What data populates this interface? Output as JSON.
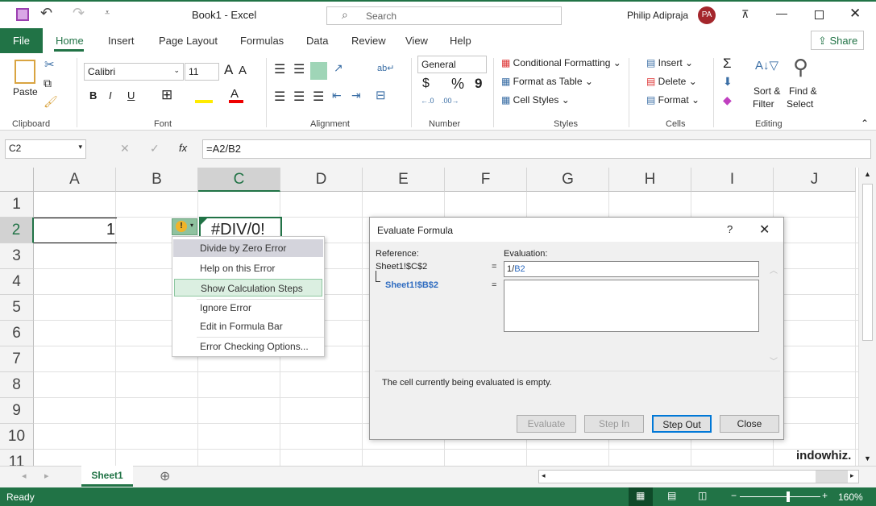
{
  "titlebar": {
    "title": "Book1  -  Excel",
    "search_placeholder": "Search",
    "user": "Philip Adipraja",
    "avatar": "PA",
    "avatar_color": "#a4262c"
  },
  "tabs": {
    "file": "File",
    "items": [
      "Home",
      "Insert",
      "Page Layout",
      "Formulas",
      "Data",
      "Review",
      "View",
      "Help"
    ],
    "active": "Home",
    "share": "Share"
  },
  "ribbon": {
    "clipboard": {
      "label": "Clipboard",
      "paste": "Paste"
    },
    "font": {
      "label": "Font",
      "name": "Calibri",
      "size": "11",
      "bold": "B",
      "italic": "I",
      "underline": "U"
    },
    "alignment": {
      "label": "Alignment"
    },
    "number": {
      "label": "Number",
      "format": "General",
      "currency": "$",
      "percent": "%",
      "comma": "9"
    },
    "styles": {
      "label": "Styles",
      "conditional": "Conditional Formatting",
      "table": "Format as Table",
      "cell_styles": "Cell Styles"
    },
    "cells": {
      "label": "Cells",
      "insert": "Insert",
      "delete": "Delete",
      "format": "Format"
    },
    "editing": {
      "label": "Editing",
      "sort": "Sort &",
      "filter": "Filter",
      "find": "Find &",
      "select": "Select"
    }
  },
  "formula_bar": {
    "name_box": "C2",
    "fx": "fx",
    "formula": "=A2/B2"
  },
  "grid": {
    "columns": [
      "A",
      "B",
      "C",
      "D",
      "E",
      "F",
      "G",
      "H",
      "I",
      "J"
    ],
    "rows": [
      "1",
      "2",
      "3",
      "4",
      "5",
      "6",
      "7",
      "8",
      "9",
      "10",
      "11"
    ],
    "cells": {
      "A2": "1",
      "C2": "#DIV/0!"
    },
    "selected": "C2"
  },
  "error_menu": {
    "items": [
      "Divide by Zero Error",
      "Help on this Error",
      "Show Calculation Steps",
      "Ignore Error",
      "Edit in Formula Bar",
      "Error Checking Options..."
    ],
    "highlighted": "Show Calculation Steps"
  },
  "dialog": {
    "title": "Evaluate Formula",
    "help": "?",
    "reference_label": "Reference:",
    "evaluation_label": "Evaluation:",
    "ref1": "Sheet1!$C$2",
    "ref2": "Sheet1!$B$2",
    "eq": "=",
    "eval_prefix": "1/",
    "eval_ref": "B2",
    "message": "The cell currently being evaluated is empty.",
    "buttons": {
      "evaluate": "Evaluate",
      "step_in": "Step In",
      "step_out": "Step Out",
      "close": "Close"
    }
  },
  "sheets": {
    "tabs": [
      "Sheet1"
    ],
    "active": "Sheet1"
  },
  "status": {
    "text": "Ready",
    "zoom": "160%",
    "zoom_level": 0.6
  },
  "watermark": "indowhiz."
}
